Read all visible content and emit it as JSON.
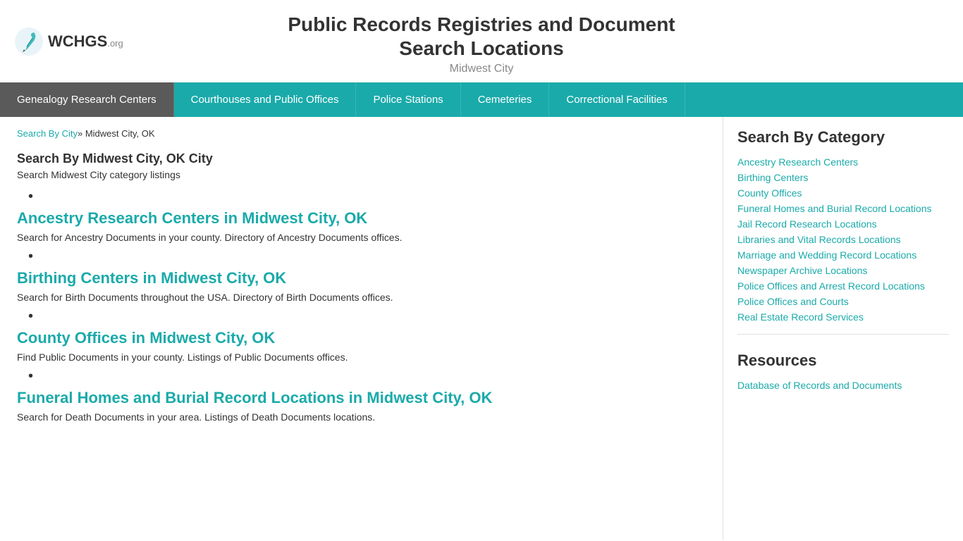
{
  "header": {
    "logo_text": "WCHGS",
    "logo_org": ".org",
    "title_line1": "Public Records Registries and Document",
    "title_line2": "Search Locations",
    "subtitle": "Midwest City"
  },
  "nav": {
    "items": [
      {
        "label": "Genealogy Research Centers",
        "active": true
      },
      {
        "label": "Courthouses and Public Offices",
        "active": false
      },
      {
        "label": "Police Stations",
        "active": false
      },
      {
        "label": "Cemeteries",
        "active": false
      },
      {
        "label": "Correctional Facilities",
        "active": false
      }
    ]
  },
  "breadcrumb": {
    "link_text": "Search By City",
    "separator": "»",
    "current": " Midwest City, OK"
  },
  "content": {
    "search_heading": "Search By Midwest City, OK City",
    "search_desc": "Search Midwest City category listings",
    "listings": [
      {
        "title": "Ancestry Research Centers in Midwest City, OK",
        "desc": "Search for Ancestry Documents in your county. Directory of Ancestry Documents offices."
      },
      {
        "title": "Birthing Centers in Midwest City, OK",
        "desc": "Search for Birth Documents throughout the USA. Directory of Birth Documents offices."
      },
      {
        "title": "County Offices in Midwest City, OK",
        "desc": "Find Public Documents in your county. Listings of Public Documents offices."
      },
      {
        "title": "Funeral Homes and Burial Record Locations in Midwest City, OK",
        "desc": "Search for Death Documents in your area. Listings of Death Documents locations."
      }
    ]
  },
  "sidebar": {
    "category_title": "Search By Category",
    "category_links": [
      "Ancestry Research Centers",
      "Birthing Centers",
      "County Offices",
      "Funeral Homes and Burial Record Locations",
      "Jail Record Research Locations",
      "Libraries and Vital Records Locations",
      "Marriage and Wedding Record Locations",
      "Newspaper Archive Locations",
      "Police Offices and Arrest Record Locations",
      "Police Offices and Courts",
      "Real Estate Record Services"
    ],
    "resources_title": "Resources",
    "resources_links": [
      "Database of Records and Documents"
    ]
  }
}
